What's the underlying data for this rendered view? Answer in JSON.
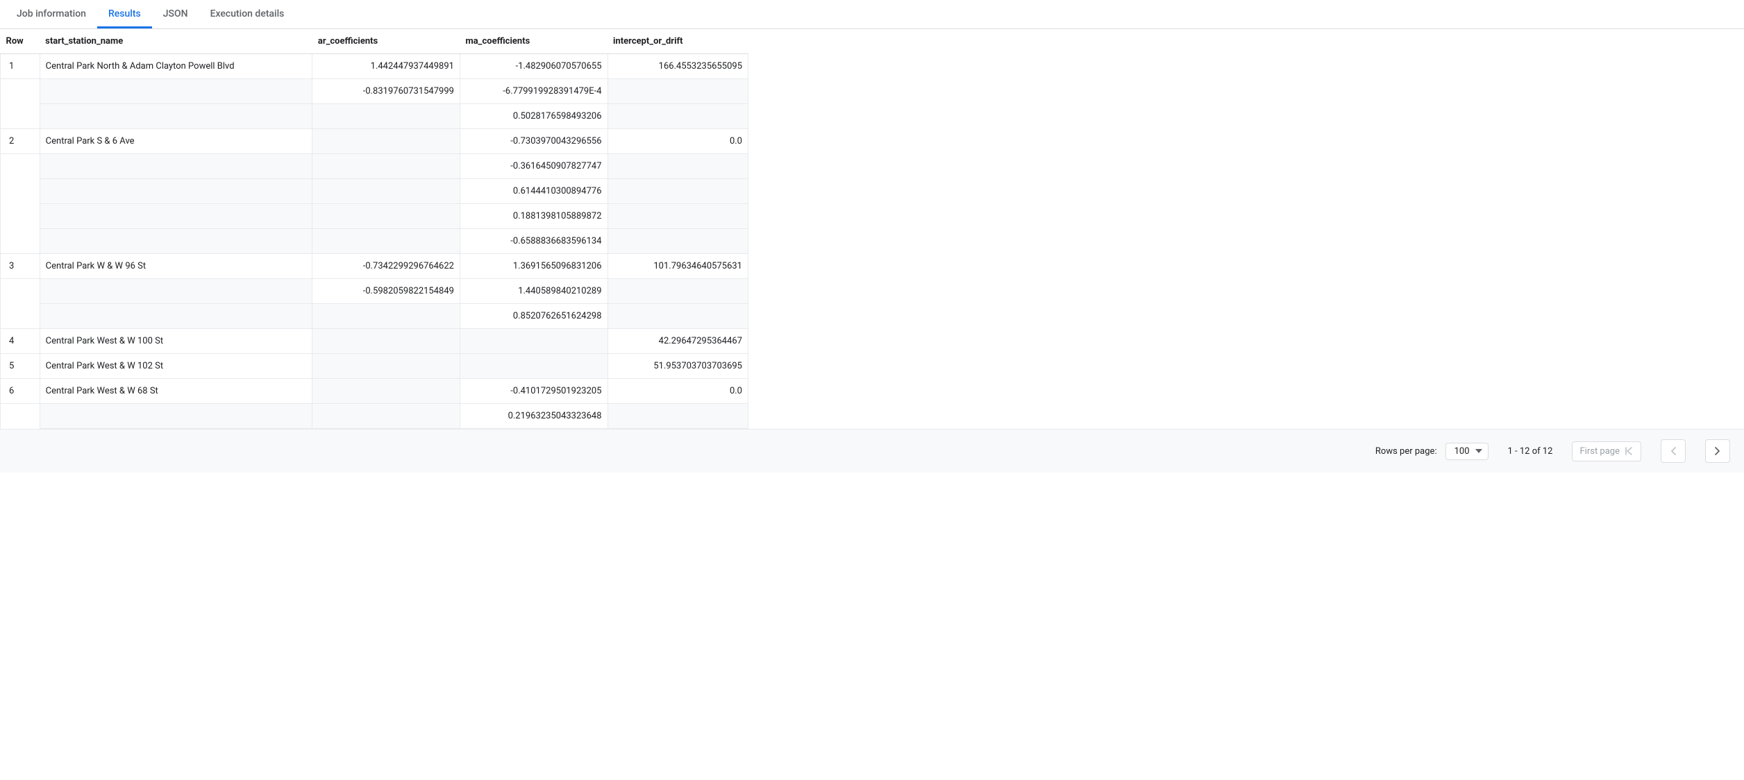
{
  "tabs": [
    {
      "label": "Job information",
      "active": false
    },
    {
      "label": "Results",
      "active": true
    },
    {
      "label": "JSON",
      "active": false
    },
    {
      "label": "Execution details",
      "active": false
    }
  ],
  "columns": {
    "row": "Row",
    "name": "start_station_name",
    "ar": "ar_coefficients",
    "ma": "ma_coefficients",
    "int": "intercept_or_drift"
  },
  "rows": [
    {
      "row": "1",
      "name": "Central Park North & Adam Clayton Powell Blvd",
      "ar": [
        "1.442447937449891",
        "-0.8319760731547999",
        ""
      ],
      "ma": [
        "-1.482906070570655",
        "-6.779919928391479E-4",
        "0.5028176598493206"
      ],
      "int": "166.4553235655095"
    },
    {
      "row": "2",
      "name": "Central Park S & 6 Ave",
      "ar": [
        "",
        "",
        "",
        "",
        ""
      ],
      "ma": [
        "-0.7303970043296556",
        "-0.3616450907827747",
        "0.6144410300894776",
        "0.1881398105889872",
        "-0.6588836683596134"
      ],
      "int": "0.0"
    },
    {
      "row": "3",
      "name": "Central Park W & W 96 St",
      "ar": [
        "-0.7342299296764622",
        "-0.5982059822154849",
        ""
      ],
      "ma": [
        "1.3691565096831206",
        "1.440589840210289",
        "0.8520762651624298"
      ],
      "int": "101.79634640575631"
    },
    {
      "row": "4",
      "name": "Central Park West & W 100 St",
      "ar": [
        ""
      ],
      "ma": [
        ""
      ],
      "int": "42.29647295364467"
    },
    {
      "row": "5",
      "name": "Central Park West & W 102 St",
      "ar": [
        ""
      ],
      "ma": [
        ""
      ],
      "int": "51.953703703703695"
    },
    {
      "row": "6",
      "name": "Central Park West & W 68 St",
      "ar": [
        "",
        ""
      ],
      "ma": [
        "-0.4101729501923205",
        "0.21963235043323648"
      ],
      "int": "0.0"
    }
  ],
  "footer": {
    "rpp_label": "Rows per page:",
    "rpp_value": "100",
    "range": "1 - 12 of 12",
    "first_page": "First page"
  }
}
